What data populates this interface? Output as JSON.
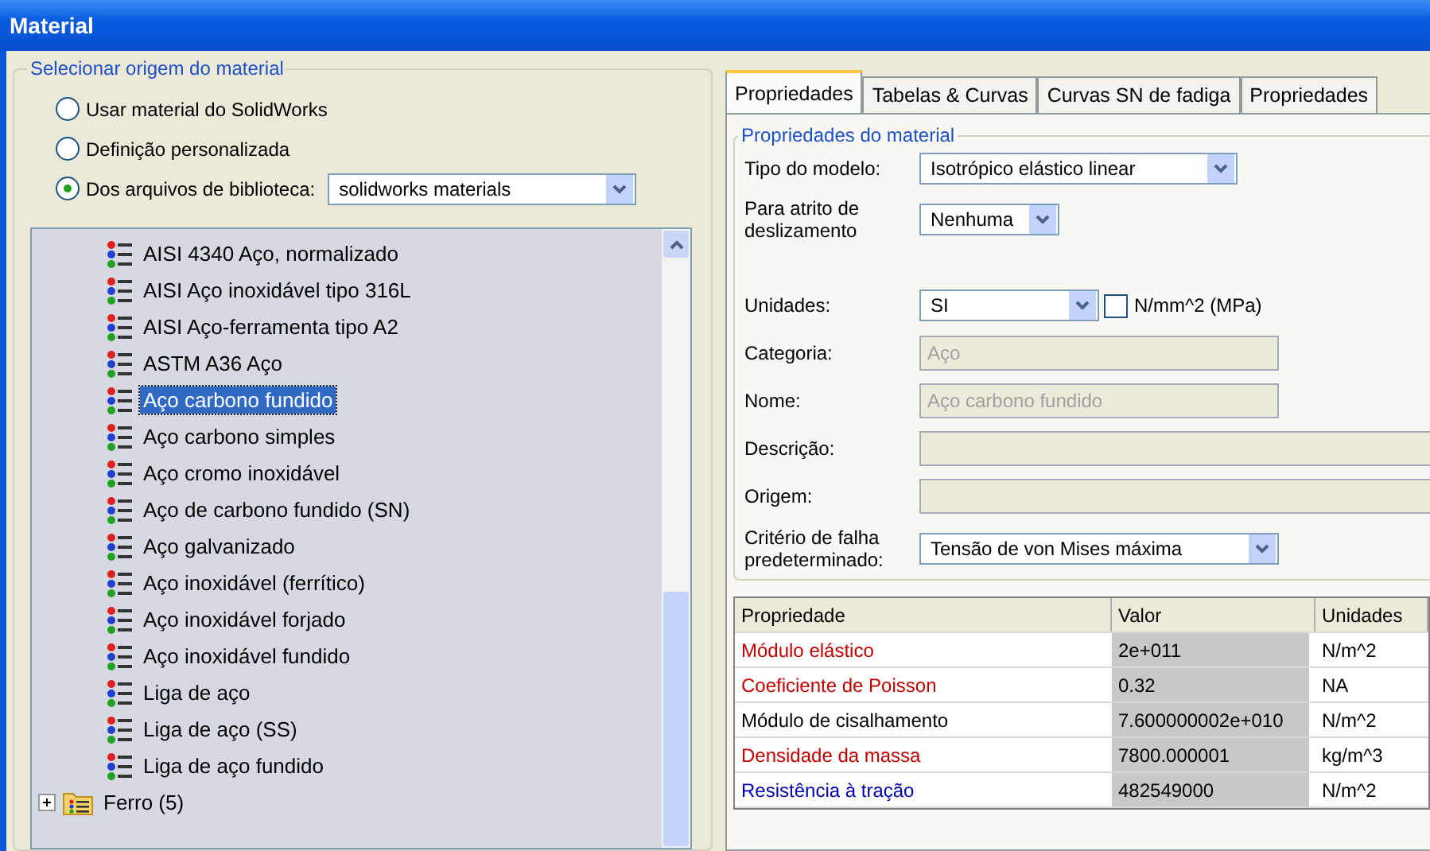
{
  "window": {
    "title": "Material"
  },
  "source_group": {
    "legend": "Selecionar origem do material",
    "options": [
      {
        "label": "Usar material do SolidWorks",
        "selected": false
      },
      {
        "label": "Definição personalizada",
        "selected": false
      },
      {
        "label": "Dos arquivos de biblioteca:",
        "selected": true
      }
    ],
    "library_select": {
      "value": "solidworks materials"
    }
  },
  "tree": {
    "items": [
      {
        "label": "AISI 4340 Aço, normalizado",
        "selected": false
      },
      {
        "label": "AISI Aço inoxidável tipo 316L",
        "selected": false
      },
      {
        "label": "AISI Aço-ferramenta tipo A2",
        "selected": false
      },
      {
        "label": "ASTM A36 Aço",
        "selected": false
      },
      {
        "label": "Aço carbono fundido",
        "selected": true
      },
      {
        "label": "Aço carbono simples",
        "selected": false
      },
      {
        "label": "Aço cromo inoxidável",
        "selected": false
      },
      {
        "label": "Aço de carbono fundido (SN)",
        "selected": false
      },
      {
        "label": "Aço galvanizado",
        "selected": false
      },
      {
        "label": "Aço inoxidável (ferrítico)",
        "selected": false
      },
      {
        "label": "Aço inoxidável forjado",
        "selected": false
      },
      {
        "label": "Aço inoxidável fundido",
        "selected": false
      },
      {
        "label": "Liga de aço",
        "selected": false
      },
      {
        "label": "Liga de aço (SS)",
        "selected": false
      },
      {
        "label": "Liga de aço fundido",
        "selected": false
      }
    ],
    "folders": [
      {
        "label": "Ferro (5)",
        "expanded": false
      }
    ]
  },
  "tabs": [
    {
      "label": "Propriedades",
      "selected": true
    },
    {
      "label": "Tabelas & Curvas",
      "selected": false
    },
    {
      "label": "Curvas SN de fadiga",
      "selected": false
    },
    {
      "label": "Propriedades",
      "selected": false
    }
  ],
  "properties_group": {
    "legend": "Propriedades do material",
    "model_type": {
      "label": "Tipo do modelo:",
      "value": "Isotrópico elástico linear"
    },
    "friction": {
      "label": "Para atrito de deslizamento",
      "value": "Nenhuma"
    },
    "units": {
      "label": "Unidades:",
      "value": "SI",
      "checkbox_label": "N/mm^2 (MPa)",
      "checked": false
    },
    "fields": [
      {
        "label": "Categoria:",
        "value": "Aço",
        "disabled": true
      },
      {
        "label": "Nome:",
        "value": "Aço carbono fundido",
        "disabled": true
      },
      {
        "label": "Descrição:"
      },
      {
        "label": "Origem:"
      }
    ],
    "failure": {
      "label": "Critério de falha predeterminado:",
      "value": "Tensão de von Mises máxima"
    }
  },
  "table": {
    "columns": [
      "Propriedade",
      "Valor",
      "Unidades"
    ],
    "rows": [
      {
        "property": "Módulo elástico",
        "value": "2e+011",
        "units": "N/m^2",
        "color": "#c00000"
      },
      {
        "property": "Coeficiente de Poisson",
        "value": "0.32",
        "units": "NA",
        "color": "#c00000"
      },
      {
        "property": "Módulo de cisalhamento",
        "value": "7.600000002e+010",
        "units": "N/m^2",
        "color": "#000000"
      },
      {
        "property": "Densidade da massa",
        "value": "7800.000001",
        "units": "kg/m^3",
        "color": "#c00000"
      },
      {
        "property": "Resistência à tração",
        "value": "482549000",
        "units": "N/m^2",
        "color": "#0000b0"
      }
    ]
  }
}
